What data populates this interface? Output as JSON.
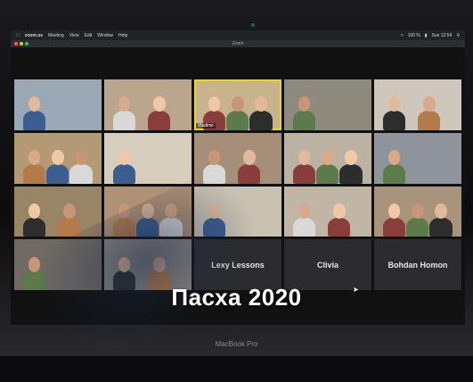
{
  "menubar": {
    "app": "zoom.us",
    "items": [
      "Meeting",
      "View",
      "Edit",
      "Window",
      "Help"
    ],
    "battery": "100 %",
    "clock": "Sun 12:54"
  },
  "window": {
    "title": "Zoom"
  },
  "tiles": [
    {
      "name": "",
      "kind": "video",
      "bg": "#9aa7b4"
    },
    {
      "name": "",
      "kind": "video",
      "bg": "#b9a68d"
    },
    {
      "name": "Vladimir",
      "kind": "video",
      "bg": "#c9b38f",
      "active": true
    },
    {
      "name": "",
      "kind": "video",
      "bg": "#8f8a7e"
    },
    {
      "name": "",
      "kind": "video",
      "bg": "#cfc7bb"
    },
    {
      "name": "",
      "kind": "video",
      "bg": "#b49a74"
    },
    {
      "name": "",
      "kind": "video",
      "bg": "#d6cdbd"
    },
    {
      "name": "",
      "kind": "video",
      "bg": "#a58f78"
    },
    {
      "name": "",
      "kind": "video",
      "bg": "#bcb2a3"
    },
    {
      "name": "",
      "kind": "video",
      "bg": "#8e939c"
    },
    {
      "name": "",
      "kind": "video",
      "bg": "#9a8466"
    },
    {
      "name": "",
      "kind": "video",
      "bg": "#b09175"
    },
    {
      "name": "",
      "kind": "video",
      "bg": "#c9c2b2"
    },
    {
      "name": "",
      "kind": "video",
      "bg": "#c1b6a6"
    },
    {
      "name": "",
      "kind": "video",
      "bg": "#a8947c"
    },
    {
      "name": "",
      "kind": "video",
      "bg": "#6f6a64"
    },
    {
      "name": "",
      "kind": "video",
      "bg": "#8c8781"
    },
    {
      "name": "Lexy Lessons",
      "kind": "label",
      "bg": "#2c2c2e"
    },
    {
      "name": "Clivia",
      "kind": "label",
      "bg": "#2c2c2e"
    },
    {
      "name": "Bohdan Homon",
      "kind": "label",
      "bg": "#2c2c2e"
    }
  ],
  "caption": "Пасха 2020",
  "device_label": "MacBook Pro"
}
